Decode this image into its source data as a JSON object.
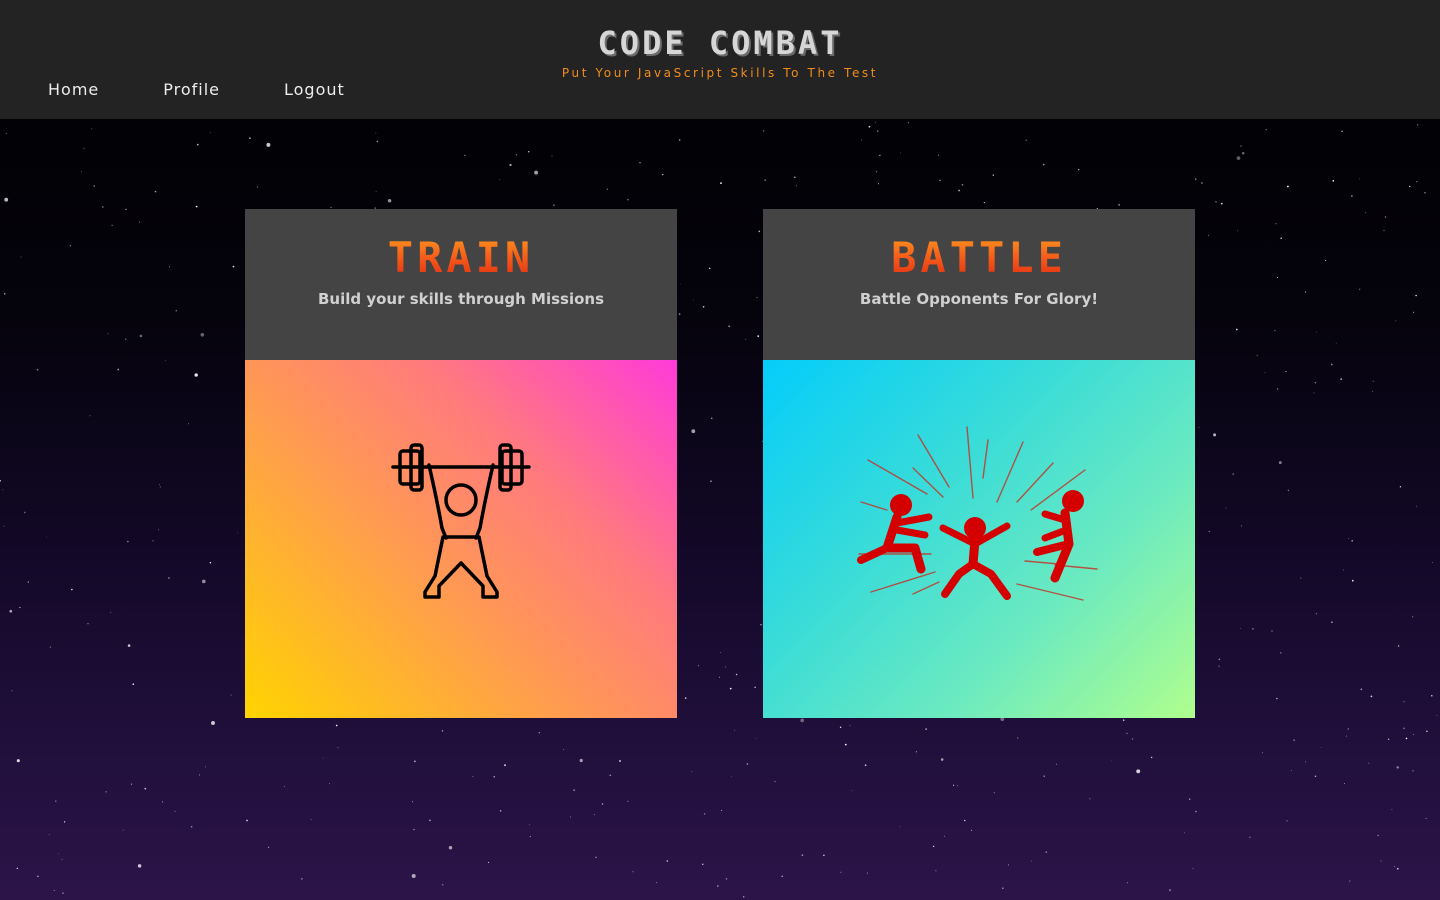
{
  "header": {
    "title": "CODE COMBAT",
    "tagline": "Put Your JavaScript Skills To The Test"
  },
  "nav": {
    "items": [
      {
        "label": "Home"
      },
      {
        "label": "Profile"
      },
      {
        "label": "Logout"
      }
    ]
  },
  "cards": [
    {
      "title": "TRAIN",
      "subtitle": "Build your skills through Missions",
      "icon": "weightlifter-icon"
    },
    {
      "title": "BATTLE",
      "subtitle": "Battle Opponents For Glory!",
      "icon": "fighting-figures-icon"
    }
  ],
  "colors": {
    "header_bg": "#232323",
    "tagline": "#f08c1c",
    "card_head_bg": "#444444",
    "card_title": "#f04a10",
    "train_gradient": [
      "#ffd400",
      "#ff3ad9"
    ],
    "battle_gradient": [
      "#04cdfa",
      "#b0fe8d"
    ],
    "fighter_red": "#d40000"
  }
}
